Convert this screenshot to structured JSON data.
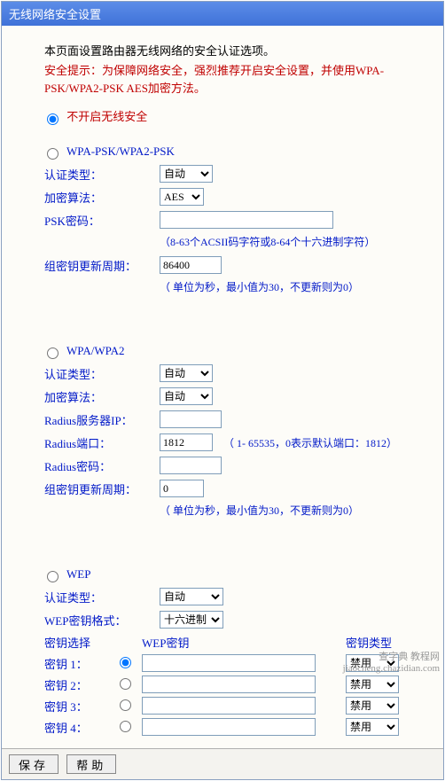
{
  "title": "无线网络安全设置",
  "intro": "本页面设置路由器无线网络的安全认证选项。",
  "warn": "安全提示：为保障网络安全，强烈推荐开启安全设置，并使用WPA-PSK/WPA2-PSK AES加密方法。",
  "radio": {
    "none": "不开启无线安全",
    "psk": "WPA-PSK/WPA2-PSK",
    "wpa": "WPA/WPA2",
    "wep": "WEP"
  },
  "labels": {
    "auth_type": "认证类型：",
    "encrypt": "加密算法：",
    "psk_pw": "PSK密码：",
    "group_key": "组密钥更新周期：",
    "radius_ip": "Radius服务器IP：",
    "radius_port": "Radius端口：",
    "radius_pw": "Radius密码：",
    "wep_fmt": "WEP密钥格式：",
    "key_select": "密钥选择",
    "wep_key_col": "WEP密钥",
    "key_type_col": "密钥类型",
    "key1": "密钥 1：",
    "key2": "密钥 2：",
    "key3": "密钥 3：",
    "key4": "密钥 4："
  },
  "options": {
    "auto": "自动",
    "aes": "AES",
    "hex": "十六进制",
    "disable": "禁用"
  },
  "values": {
    "group_key1": "86400",
    "radius_port": "1812",
    "group_key2": "0"
  },
  "hints": {
    "psk_pw": "（8-63个ACSII码字符或8-64个十六进制字符）",
    "gk": "（ 单位为秒，最小值为30，不更新则为0）",
    "radius_port": "（ 1- 65535，0表示默认端口：1812）"
  },
  "buttons": {
    "save": "保存",
    "help": "帮助"
  },
  "watermark": {
    "l1": "查字典 教程网",
    "l2": "jiaocheng.chazidian.com"
  }
}
